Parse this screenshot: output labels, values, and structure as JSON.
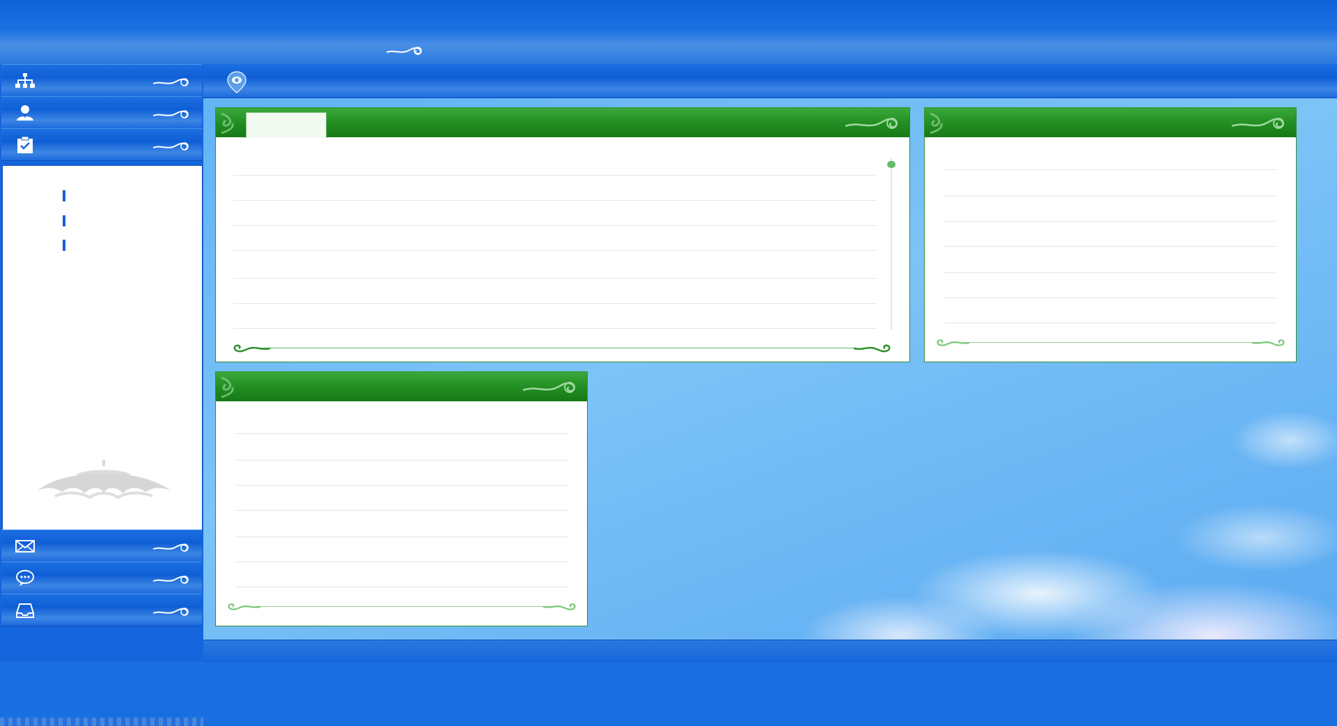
{
  "header": {
    "title": ""
  },
  "sidebar": {
    "items": [
      {
        "icon": "org-chart-icon",
        "label": ""
      },
      {
        "icon": "user-icon",
        "label": ""
      },
      {
        "icon": "clipboard-check-icon",
        "label": ""
      },
      {
        "icon": "mail-icon",
        "label": ""
      },
      {
        "icon": "chat-icon",
        "label": ""
      },
      {
        "icon": "inbox-icon",
        "label": ""
      }
    ],
    "submenu": [
      "",
      "",
      ""
    ]
  },
  "location": {
    "icon": "map-pin-icon",
    "text": ""
  },
  "panels": {
    "main": {
      "tab_label": ""
    },
    "right": {
      "title": ""
    },
    "bottom": {
      "title": ""
    }
  },
  "colors": {
    "primary": "#1565dc",
    "panel_header": "#1f8a1f",
    "sky": "#6bb8f5"
  }
}
